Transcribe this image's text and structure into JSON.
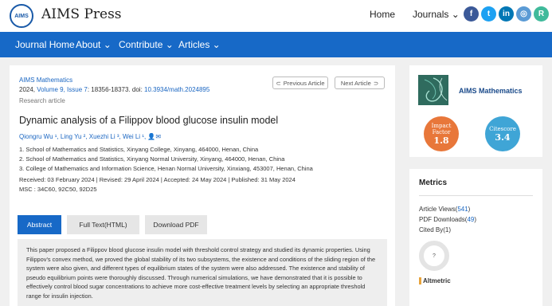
{
  "header": {
    "logo_text": "AIMS",
    "brand": "AIMS Press",
    "home": "Home",
    "journals": "Journals ⌄",
    "social": [
      {
        "icon": "facebook-icon",
        "glyph": "f",
        "color": "#3b5998"
      },
      {
        "icon": "twitter-icon",
        "glyph": "t",
        "color": "#1da1f2"
      },
      {
        "icon": "linkedin-icon",
        "glyph": "in",
        "color": "#0077b5"
      },
      {
        "icon": "wechat-icon",
        "glyph": "◎",
        "color": "#5b9bd5"
      },
      {
        "icon": "researchgate-icon",
        "glyph": "R",
        "color": "#40ba9b"
      }
    ]
  },
  "nav": {
    "journal_home": "Journal Home",
    "about": "About ⌄",
    "contribute": "Contribute ⌄",
    "articles": "Articles ⌄"
  },
  "article": {
    "journal": "AIMS Mathematics",
    "year_pages_prefix": "2024, ",
    "volume_issue": "Volume 9, Issue 7",
    "pages_doi": ": 18356-18373. doi: ",
    "doi": "10.3934/math.2024895",
    "type": "Research article",
    "prev": "Previous Article",
    "next": "Next Article",
    "title": "Dynamic analysis of a Filippov blood glucose insulin model",
    "authors": "Qiongru Wu ¹, Ling Yu ², Xuezhi Li ³, Wei Li ¹,",
    "affiliations": [
      "1. School of Mathematics and Statistics, Xinyang College, Xinyang, 464000, Henan, China",
      "2. School of Mathematics and Statistics, Xinyang Normal University, Xinyang, 464000, Henan, China",
      "3. College of Mathematics and Information Science, Henan Normal University, Xinxiang, 453007, Henan, China"
    ],
    "dates": "Received: 03 February 2024  |  Revised: 29 April 2024  |  Accepted: 24 May 2024  |  Published: 31 May 2024",
    "msc": "MSC : 34C60, 92C50, 92D25"
  },
  "tabs": {
    "abstract": "Abstract",
    "fulltext": "Full Text(HTML)",
    "pdf": "Download PDF"
  },
  "abstract_text": "This paper proposed a Filippov blood glucose insulin model with threshold control strategy and studied its dynamic properties. Using Filippov's convex method, we proved the global stability of its two subsystems, the existence and conditions of the sliding region of the system were also given, and different types of equilibrium states of the system were also addressed. The existence and stability of pseudo equilibrium points were thoroughly discussed. Through numerical simulations, we have demonstrated that it is possible to effectively control blood sugar concentrations to achieve more cost-effective treatment levels by selecting an appropriate threshold range for insulin injection.",
  "sidebar": {
    "journal": "AIMS Mathematics",
    "impact_label": "Impact Factor",
    "impact_value": "1.8",
    "citescore_label": "Citescore",
    "citescore_value": "3.4",
    "metrics_heading": "Metrics",
    "views_label": "Article Views(",
    "views_value": "541",
    "downloads_label": "PDF Downloads(",
    "downloads_value": "49",
    "cited_label": "Cited By(1)",
    "donut_text": "?",
    "altmetric": "Altmetric"
  }
}
